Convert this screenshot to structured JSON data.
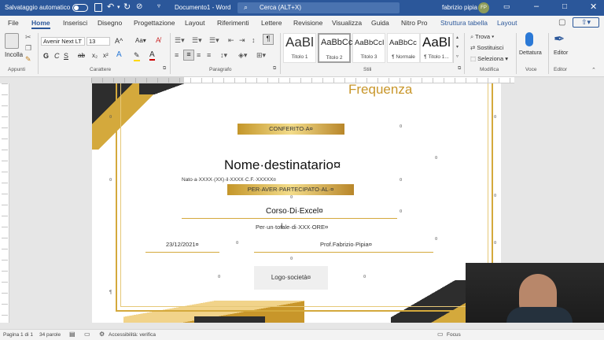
{
  "titlebar": {
    "autosave_label": "Salvataggio automatico",
    "document_title": "Documento1 - Word",
    "search_placeholder": "Cerca (ALT+X)",
    "user_name": "fabrizio pipia",
    "user_initials": "FP"
  },
  "tabs": [
    "File",
    "Home",
    "Inserisci",
    "Disegno",
    "Progettazione",
    "Layout",
    "Riferimenti",
    "Lettere",
    "Revisione",
    "Visualizza",
    "Guida",
    "Nitro Pro",
    "Struttura tabella",
    "Layout"
  ],
  "ribbon": {
    "clipboard": {
      "paste_label": "Incolla",
      "group_label": "Appunti"
    },
    "font": {
      "font_name": "Avenir Next LT",
      "font_size": "13",
      "group_label": "Carattere"
    },
    "paragraph": {
      "group_label": "Paragrafo"
    },
    "styles": {
      "group_label": "Stili",
      "items": [
        {
          "sample": "AaBl",
          "name": "Titolo 1"
        },
        {
          "sample": "AaBbCc",
          "name": "Titolo 2"
        },
        {
          "sample": "AaBbCcI",
          "name": "Titolo 3"
        },
        {
          "sample": "AaBbCc",
          "name": "¶ Normale"
        },
        {
          "sample": "AaBl",
          "name": "¶ Titolo 1..."
        }
      ]
    },
    "editing": {
      "find": "Trova",
      "replace": "Sostituisci",
      "select": "Seleziona",
      "group_label": "Modifica"
    },
    "voice": {
      "dictate": "Dettatura",
      "group_label": "Voce"
    },
    "editor": {
      "label": "Editor",
      "group_label": "Editor"
    }
  },
  "document": {
    "frequency_title": "Frequenza",
    "conferred": "CONFERITO·A¤",
    "recipient_name": "Nome·destinatario¤",
    "birth_info": "Nato·a·XXXX·(XX)·il·XXXX·C.F.·XXXXX¤",
    "participation": "PER·AVER·PARTECIPATO·AL·¤",
    "course_name": "Corso·Di·Excel¤",
    "total_hours": "Per·un·totale·di·XXX·ORE¤",
    "date": "23/12/2021¤",
    "teacher": "Prof.Fabrizio·Pipia¤",
    "company_logo": "Logo·società¤"
  },
  "statusbar": {
    "page": "Pagina 1 di 1",
    "words": "34 parole",
    "accessibility": "Accessibilità: verifica",
    "focus": "Focus"
  },
  "colors": {
    "word_blue": "#2b579a",
    "gold": "#d4a93c",
    "dark_band": "#2d2d2d"
  }
}
